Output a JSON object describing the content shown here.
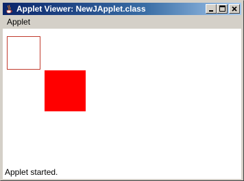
{
  "window": {
    "title": "Applet Viewer: NewJApplet.class",
    "app_icon": "java-cup-icon"
  },
  "title_buttons": {
    "minimize_icon": "minimize-icon",
    "maximize_icon": "maximize-icon",
    "close_icon": "close-icon"
  },
  "menubar": {
    "items": [
      {
        "label": "Applet"
      }
    ]
  },
  "canvas": {
    "shapes": [
      {
        "kind": "outlined-square",
        "stroke": "#c0392b",
        "fill": "#ffffff"
      },
      {
        "kind": "filled-square",
        "fill": "#ff0000"
      }
    ]
  },
  "status": {
    "text": "Applet started."
  },
  "colors": {
    "titlebar_start": "#0a246a",
    "titlebar_end": "#a6caf0",
    "chrome": "#d4d0c8",
    "canvas_bg": "#ffffff"
  }
}
